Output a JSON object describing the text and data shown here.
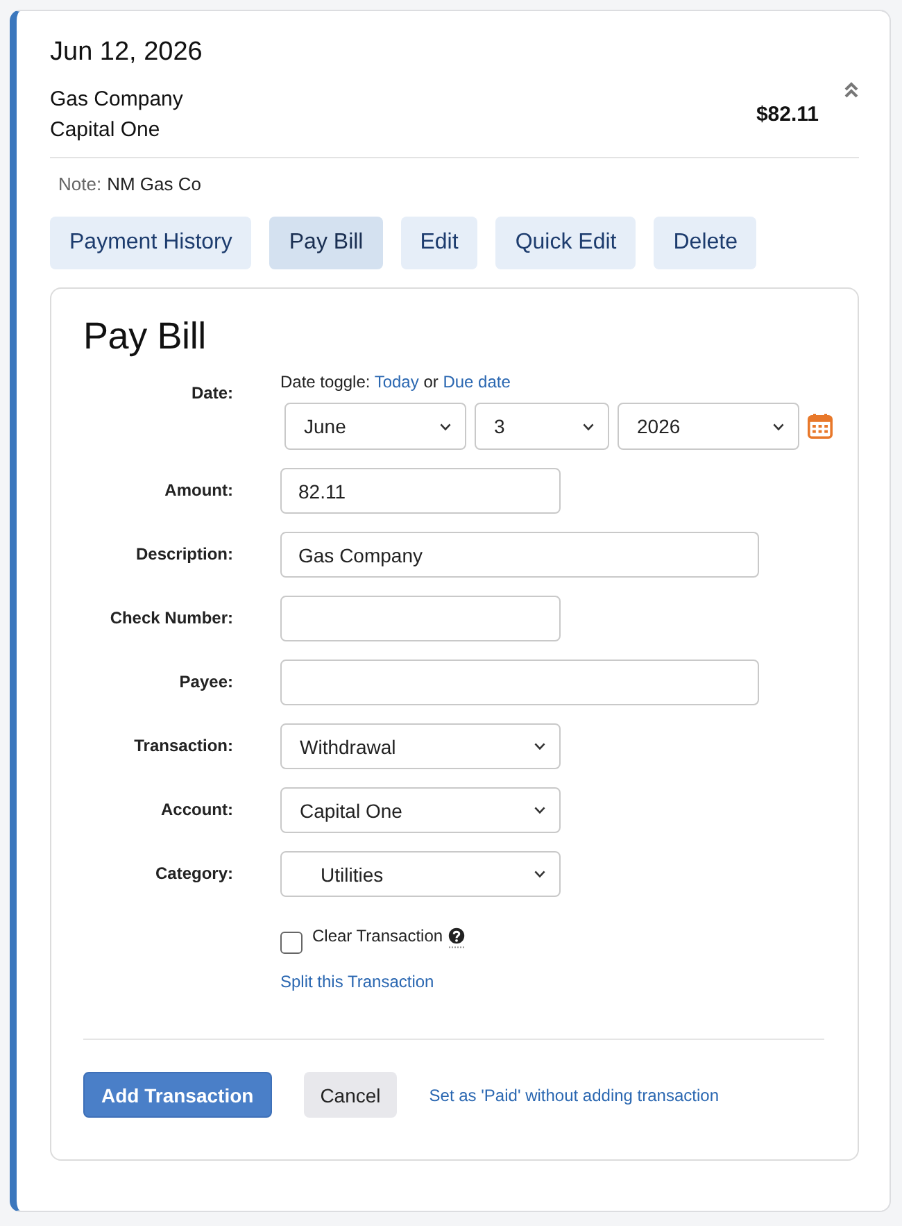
{
  "card": {
    "date": "Jun 12, 2026",
    "description": "Gas Company",
    "account": "Capital One",
    "amount": "$82.11",
    "expanded": true,
    "note": {
      "label": "Note:",
      "text": "NM Gas Co"
    }
  },
  "actions": [
    {
      "label": "Payment History",
      "selected": false
    },
    {
      "label": "Pay Bill",
      "selected": true
    },
    {
      "label": "Edit",
      "selected": false
    },
    {
      "label": "Quick Edit",
      "selected": false
    },
    {
      "label": "Delete",
      "selected": false
    }
  ],
  "pay_bill": {
    "title": "Pay Bill",
    "date": {
      "label": "Date:",
      "toggle_label": "Date toggle:",
      "toggle_links": [
        "Today",
        "Due date"
      ],
      "toggle_joiner": "or",
      "month": "June",
      "day": "3",
      "year": "2026"
    },
    "fields": [
      {
        "label": "Amount:",
        "kind": "number",
        "value": "82.11"
      },
      {
        "label": "Description:",
        "kind": "text",
        "value": "Gas Company"
      },
      {
        "label": "Check Number:",
        "kind": "number"
      },
      {
        "label": "Payee:",
        "kind": "text"
      },
      {
        "label": "Transaction:",
        "kind": "select",
        "value": "Withdrawal",
        "indented": false
      },
      {
        "label": "Account:",
        "kind": "select",
        "value": "Capital One",
        "indented": false
      },
      {
        "label": "Category:",
        "kind": "select",
        "value": "Utilities",
        "indented": true
      }
    ],
    "clear_transaction": {
      "label": "Clear Transaction",
      "checked": false
    },
    "split_link": "Split this Transaction",
    "buttons": [
      {
        "label": "Add Transaction",
        "kind": "primary"
      },
      {
        "label": "Cancel",
        "kind": "secondary"
      },
      {
        "label": "Set as 'Paid' without adding transaction",
        "kind": "link"
      }
    ]
  }
}
